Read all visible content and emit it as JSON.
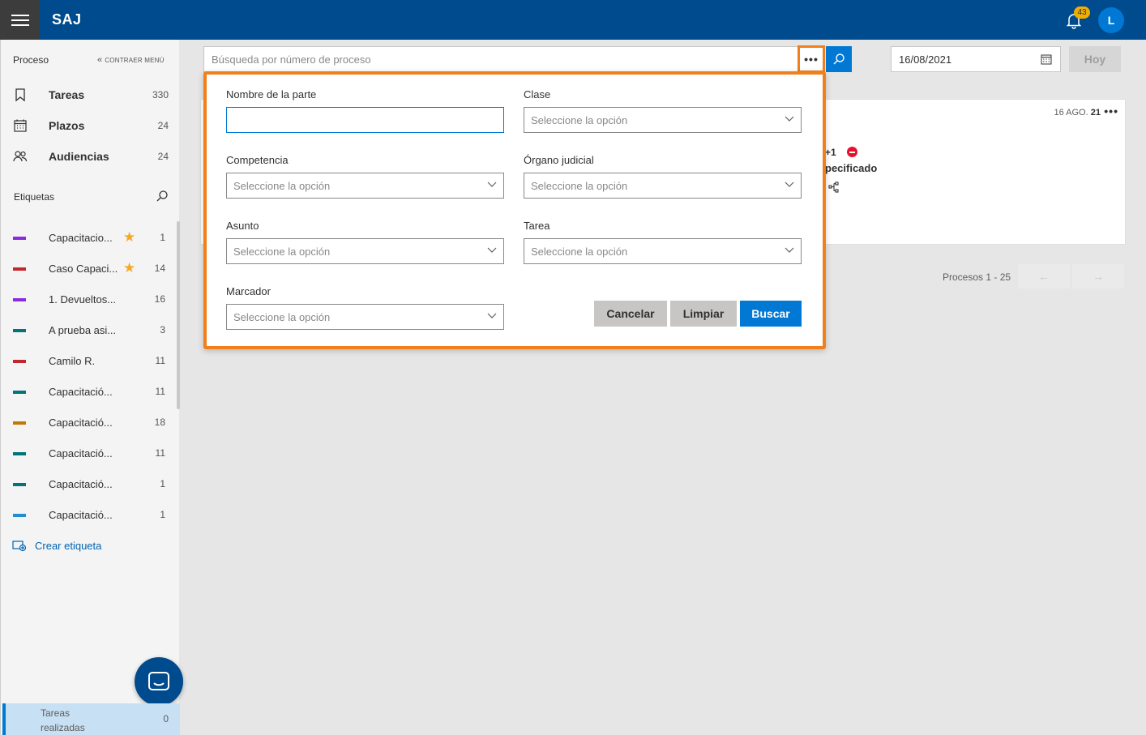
{
  "app": {
    "title": "SAJ",
    "notification_count": "43",
    "user_initial": "L"
  },
  "sidebar": {
    "header": "Proceso",
    "collapse_label": "CONTRAER MENÚ",
    "nav": [
      {
        "label": "Tareas",
        "count": "330",
        "icon": "bookmark-icon"
      },
      {
        "label": "Plazos",
        "count": "24",
        "icon": "calendar-icon"
      },
      {
        "label": "Audiencias",
        "count": "24",
        "icon": "people-icon"
      }
    ],
    "tags_header": "Etiquetas",
    "tags": [
      {
        "label": "Capacitacio...",
        "count": "1",
        "color": "#8a2be2",
        "starred": true
      },
      {
        "label": "Caso Capaci...",
        "count": "14",
        "color": "#c4262e",
        "starred": true
      },
      {
        "label": "1. Devueltos...",
        "count": "16",
        "color": "#8a2be2",
        "starred": false
      },
      {
        "label": "A prueba asi...",
        "count": "3",
        "color": "#00757a",
        "starred": false
      },
      {
        "label": "Camilo R.",
        "count": "11",
        "color": "#c4262e",
        "starred": false
      },
      {
        "label": "Capacitació...",
        "count": "11",
        "color": "#00757a",
        "starred": false
      },
      {
        "label": "Capacitació...",
        "count": "18",
        "color": "#c17a00",
        "starred": false
      },
      {
        "label": "Capacitació...",
        "count": "11",
        "color": "#00757a",
        "starred": false
      },
      {
        "label": "Capacitació...",
        "count": "1",
        "color": "#00757a",
        "starred": false
      },
      {
        "label": "Capacitació...",
        "count": "1",
        "color": "#1f8fd1",
        "starred": false
      }
    ],
    "create_tag": "Crear etiqueta",
    "done": {
      "label": "Tareas realizadas",
      "count": "0"
    }
  },
  "search": {
    "placeholder": "Búsqueda por número de proceso",
    "date": "16/08/2021",
    "today_label": "Hoy"
  },
  "card": {
    "date_prefix": "16 AGO.",
    "date_year": "21",
    "extra": "+1",
    "text": "pecificado"
  },
  "pager": {
    "label": "Procesos 1 - 25"
  },
  "advanced_search": {
    "party_name": {
      "label": "Nombre de la parte",
      "value": ""
    },
    "clase": {
      "label": "Clase",
      "placeholder": "Seleccione la opción"
    },
    "competencia": {
      "label": "Competencia",
      "placeholder": "Seleccione la opción"
    },
    "organo": {
      "label": "Órgano judicial",
      "placeholder": "Seleccione la opción"
    },
    "asunto": {
      "label": "Asunto",
      "placeholder": "Seleccione la opción"
    },
    "tarea": {
      "label": "Tarea",
      "placeholder": "Seleccione la opción"
    },
    "marcador": {
      "label": "Marcador",
      "placeholder": "Seleccione la opción"
    },
    "cancel": "Cancelar",
    "clear": "Limpiar",
    "search": "Buscar"
  }
}
